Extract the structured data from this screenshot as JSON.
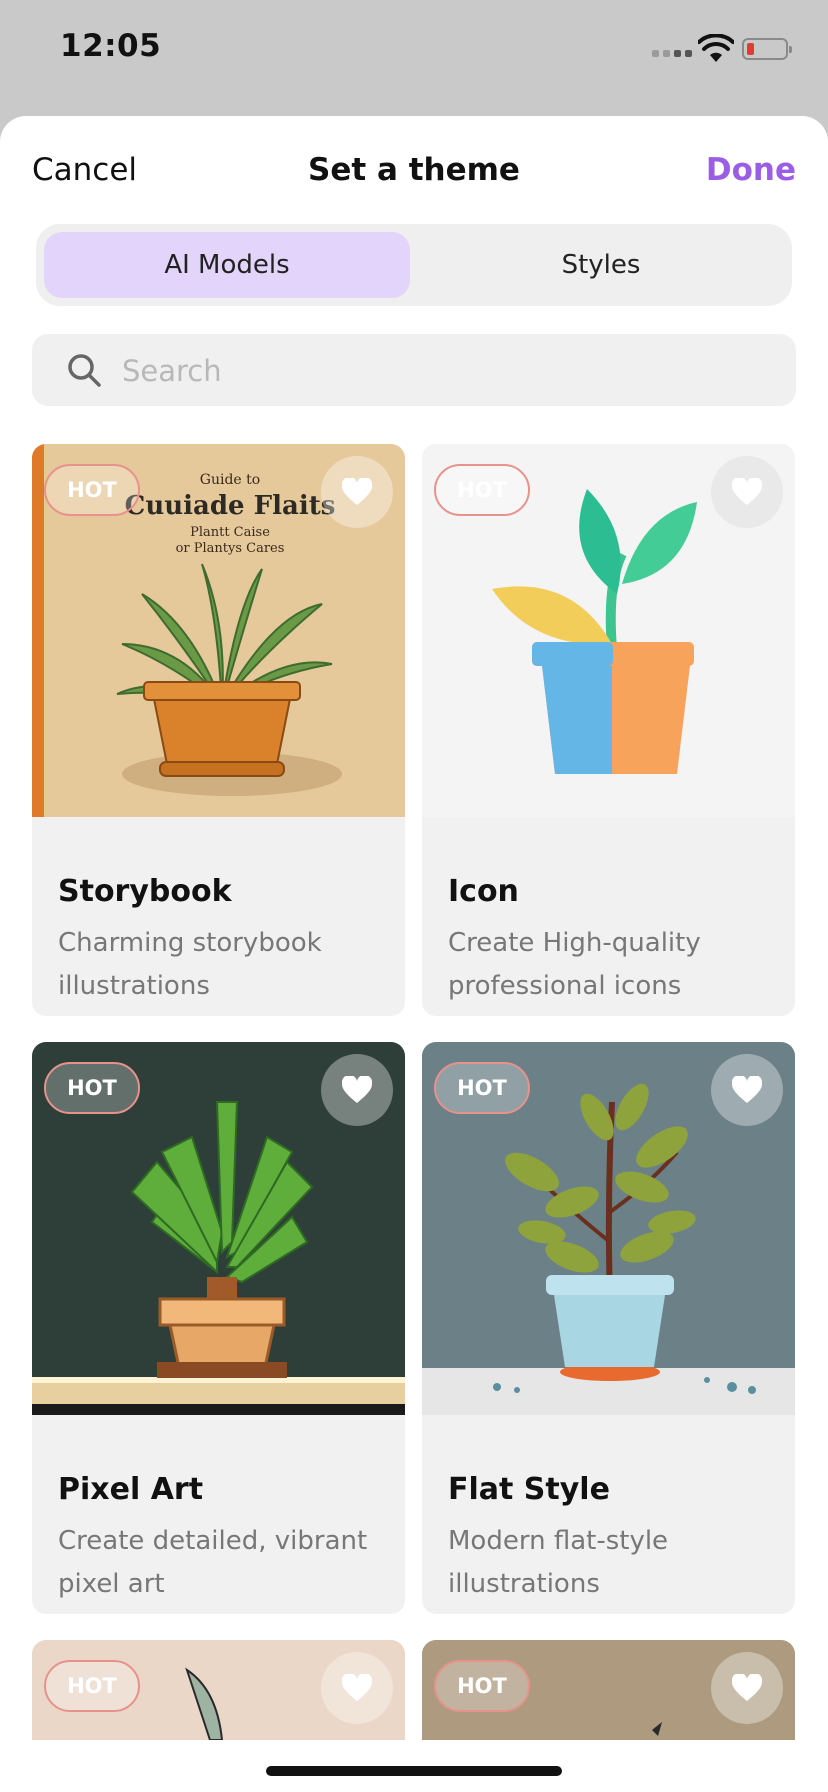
{
  "status_bar": {
    "time": "12:05",
    "battery_color": "#e53935"
  },
  "nav": {
    "cancel_label": "Cancel",
    "title": "Set a theme",
    "done_label": "Done",
    "accent_color": "#9b5de5"
  },
  "segments": [
    {
      "label": "AI Models",
      "selected": true
    },
    {
      "label": "Styles",
      "selected": false
    }
  ],
  "search": {
    "placeholder": "Search",
    "value": ""
  },
  "cards": [
    {
      "badge": "HOT",
      "name": "Storybook",
      "description": "Charming storybook illustrations",
      "book_title": "Cuuiade Flaits",
      "book_lines": [
        "Guide to",
        "Plantt Caise",
        "or Plantys Cares"
      ],
      "icon": "heart-icon"
    },
    {
      "badge": "HOT",
      "name": "Icon",
      "description": "Create High-quality professional icons",
      "icon": "heart-icon"
    },
    {
      "badge": "HOT",
      "name": "Pixel Art",
      "description": "Create detailed, vibrant pixel art",
      "icon": "heart-icon"
    },
    {
      "badge": "HOT",
      "name": "Flat Style",
      "description": "Modern flat-style illustrations",
      "icon": "heart-icon"
    },
    {
      "badge": "HOT",
      "icon": "heart-icon"
    },
    {
      "badge": "HOT",
      "icon": "heart-icon"
    }
  ]
}
